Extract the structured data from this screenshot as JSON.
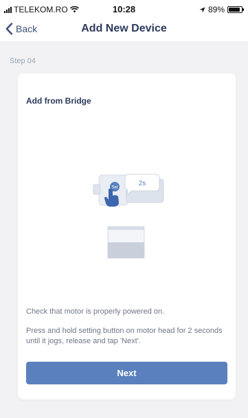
{
  "status_bar": {
    "carrier": "TELEKOM.RO",
    "time": "10:28",
    "battery": "89%",
    "battery_level": 0.89,
    "icons": [
      "signal-icon",
      "wifi-icon",
      "location-icon",
      "battery-icon"
    ]
  },
  "nav": {
    "back_label": "Back",
    "title": "Add New Device"
  },
  "step": "Step 04",
  "card": {
    "title": "Add from Bridge",
    "illustration": {
      "button_label": "Set",
      "bubble_text": "2s"
    },
    "note_power": "Check that motor is properly powered on.",
    "note_hold": "Press and hold setting button on motor head for 2 seconds until it jogs, release and tap 'Next'.",
    "next_label": "Next"
  },
  "colors": {
    "accent": "#5a80bd",
    "title": "#2b3a5c",
    "background": "#f2f2f4"
  }
}
